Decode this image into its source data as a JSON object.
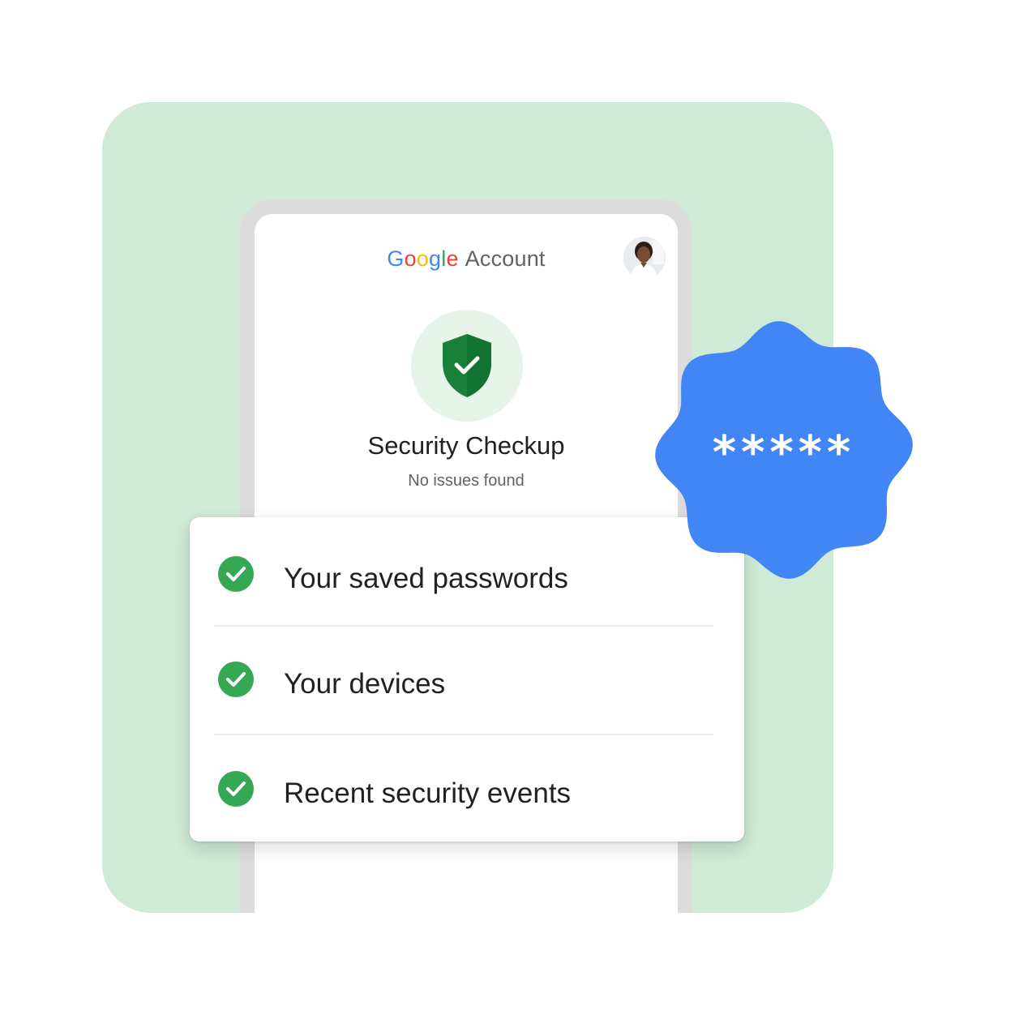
{
  "header": {
    "brand_letters": [
      "G",
      "o",
      "o",
      "g",
      "l",
      "e"
    ],
    "brand_suffix": "Account"
  },
  "checkup": {
    "title": "Security Checkup",
    "status": "No issues found"
  },
  "checks": [
    {
      "label": "Your saved passwords",
      "icon": "check-circle-icon"
    },
    {
      "label": "Your devices",
      "icon": "check-circle-icon"
    },
    {
      "label": "Recent security events",
      "icon": "check-circle-icon"
    }
  ],
  "badge": {
    "text": "*****"
  },
  "colors": {
    "background_tile": "#cfead6",
    "badge": "#4285f4",
    "check_green": "#34a853",
    "shield_green": "#188038",
    "google_blue": "#4285f4",
    "google_red": "#ea4335",
    "google_yellow": "#fbbc05",
    "google_green": "#34a853"
  }
}
